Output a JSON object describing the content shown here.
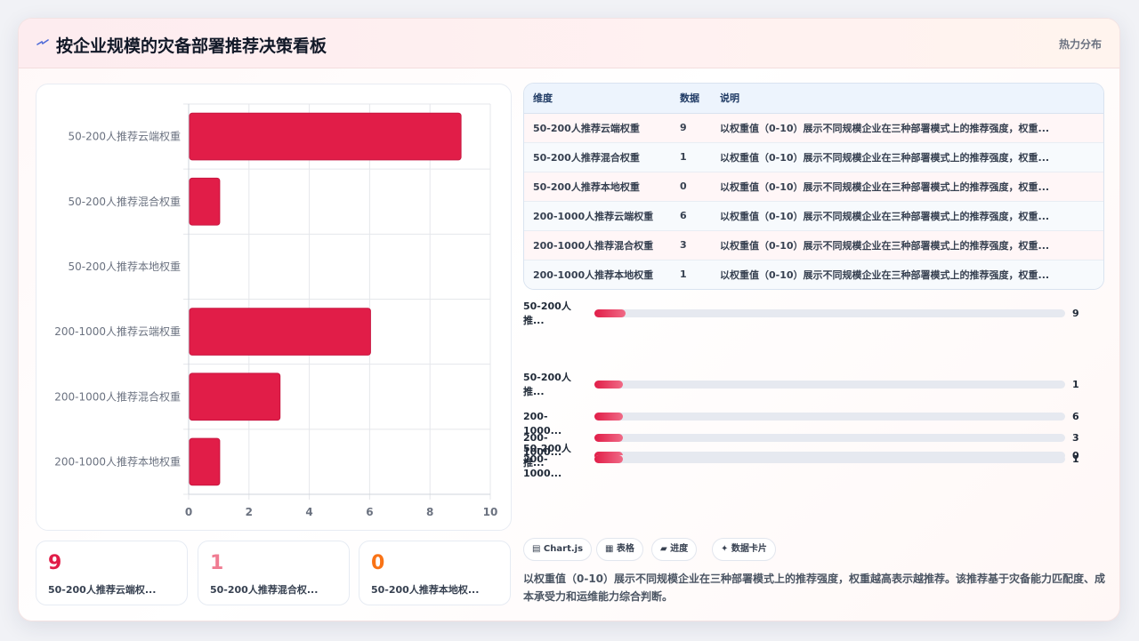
{
  "header": {
    "title": "按企业规模的灾备部署推荐决策看板",
    "tag": "热力分布",
    "logo_icon": "lightning-icon"
  },
  "colors": {
    "bar": "#e11d48",
    "accent_red": "#e11d48",
    "accent_pink": "#f07c92",
    "accent_orange": "#f97316"
  },
  "chart_data": {
    "type": "bar",
    "orientation": "horizontal",
    "categories": [
      "50-200人推荐云端权重",
      "50-200人推荐混合权重",
      "50-200人推荐本地权重",
      "200-1000人推荐云端权重",
      "200-1000人推荐混合权重",
      "200-1000人推荐本地权重"
    ],
    "values": [
      9,
      1,
      0,
      6,
      3,
      1
    ],
    "xlim": [
      0,
      10
    ],
    "xticks": [
      "0",
      "2",
      "4",
      "6",
      "8",
      "10"
    ],
    "grid": true
  },
  "stats": [
    {
      "value": "9",
      "label": "50-200人推荐云端权...",
      "color": "#e11d48"
    },
    {
      "value": "1",
      "label": "50-200人推荐混合权...",
      "color": "#f07c92"
    },
    {
      "value": "0",
      "label": "50-200人推荐本地权...",
      "color": "#f97316"
    }
  ],
  "table": {
    "headers": [
      "维度",
      "数据",
      "说明"
    ],
    "rows": [
      [
        "50-200人推荐云端权重",
        "9",
        "以权重值（0-10）展示不同规模企业在三种部署模式上的推荐强度，权重..."
      ],
      [
        "50-200人推荐混合权重",
        "1",
        "以权重值（0-10）展示不同规模企业在三种部署模式上的推荐强度，权重..."
      ],
      [
        "50-200人推荐本地权重",
        "0",
        "以权重值（0-10）展示不同规模企业在三种部署模式上的推荐强度，权重..."
      ],
      [
        "200-1000人推荐云端权重",
        "6",
        "以权重值（0-10）展示不同规模企业在三种部署模式上的推荐强度，权重..."
      ],
      [
        "200-1000人推荐混合权重",
        "3",
        "以权重值（0-10）展示不同规模企业在三种部署模式上的推荐强度，权重..."
      ],
      [
        "200-1000人推荐本地权重",
        "1",
        "以权重值（0-10）展示不同规模企业在三种部署模式上的推荐强度，权重..."
      ]
    ]
  },
  "progress": [
    {
      "label_line1": "50-200人",
      "label_line2": "推...",
      "value": "9",
      "fraction": 0.067
    },
    {
      "label_line1": "50-200人",
      "label_line2": "推...",
      "value": "1",
      "fraction": 0.06
    },
    {
      "label_line1": "50-200人",
      "label_line2": "推...",
      "value": "0",
      "fraction": 0.06
    },
    {
      "label_line1": "200-1000...",
      "label_line2": "",
      "value": "6",
      "fraction": 0.06
    },
    {
      "label_line1": "200-1000...",
      "label_line2": "",
      "value": "3",
      "fraction": 0.06
    },
    {
      "label_line1": "200-1000...",
      "label_line2": "",
      "value": "1",
      "fraction": 0.06
    }
  ],
  "chips": [
    {
      "icon": "chart-icon",
      "label": "▤ Chart.js"
    },
    {
      "icon": "table-icon",
      "label": "▦ 表格"
    },
    {
      "icon": "progress-icon",
      "label": "▰ 进度"
    },
    {
      "icon": "sparkle-icon",
      "label": "✦ 数据卡片"
    }
  ],
  "description": "以权重值（0-10）展示不同规模企业在三种部署模式上的推荐强度，权重越高表示越推荐。该推荐基于灾备能力匹配度、成本承受力和运维能力综合判断。"
}
